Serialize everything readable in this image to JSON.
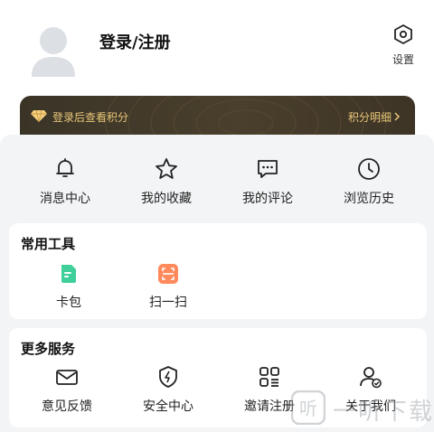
{
  "header": {
    "login_title": "登录/注册",
    "settings_label": "设置"
  },
  "banner": {
    "left_text": "登录后查看积分",
    "right_text": "积分明细"
  },
  "quick": [
    {
      "label": "消息中心",
      "icon": "bell-icon"
    },
    {
      "label": "我的收藏",
      "icon": "star-icon"
    },
    {
      "label": "我的评论",
      "icon": "comment-icon"
    },
    {
      "label": "浏览历史",
      "icon": "clock-icon"
    }
  ],
  "tools": {
    "title": "常用工具",
    "items": [
      {
        "label": "卡包",
        "icon": "card-wallet-icon",
        "color": "#3ecf9a"
      },
      {
        "label": "扫一扫",
        "icon": "scan-icon",
        "color": "#ff8a5b"
      }
    ]
  },
  "services": {
    "title": "更多服务",
    "items": [
      {
        "label": "意见反馈",
        "icon": "mail-icon"
      },
      {
        "label": "安全中心",
        "icon": "shield-icon"
      },
      {
        "label": "邀请注册",
        "icon": "grid-icon"
      },
      {
        "label": "关于我们",
        "icon": "user-check-icon"
      }
    ]
  },
  "watermark": {
    "text": "一听下载"
  }
}
